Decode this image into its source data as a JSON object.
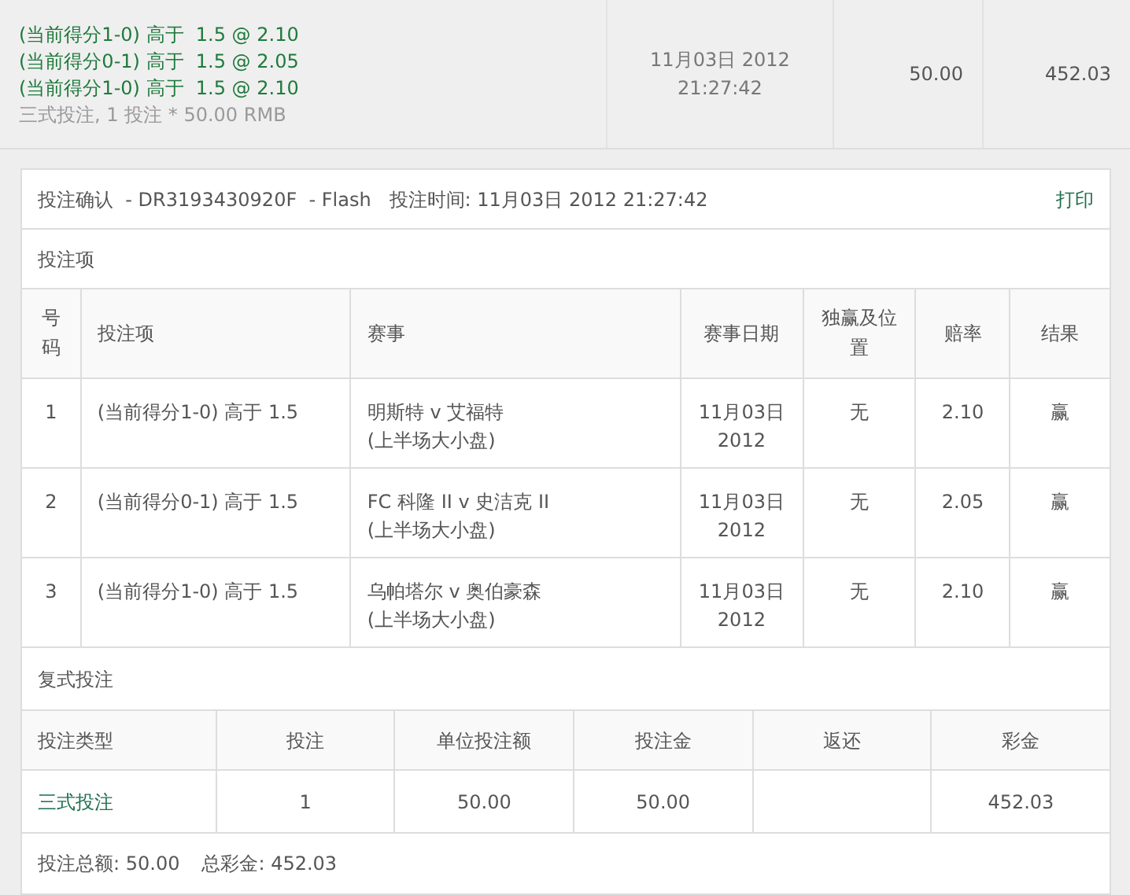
{
  "summary": {
    "selections": [
      "(当前得分1-0) 高于  1.5 @ 2.10",
      "(当前得分0-1) 高于  1.5 @ 2.05",
      "(当前得分1-0) 高于  1.5 @ 2.10"
    ],
    "bet_info": "三式投注, 1 投注 * 50.00 RMB",
    "date": "11月03日 2012",
    "time": "21:27:42",
    "stake": "50.00",
    "return": "452.03"
  },
  "confirmation": {
    "title": "投注确认  - DR3193430920F  - Flash   投注时间: 11月03日 2012 21:27:42",
    "print_link": "打印"
  },
  "selections_section": {
    "title": "投注项",
    "columns": [
      "号码",
      "投注项",
      "赛事",
      "赛事日期",
      "独赢及位置",
      "赔率",
      "结果"
    ],
    "rows": [
      {
        "number": "1",
        "selection": "(当前得分1-0) 高于 1.5",
        "event": "明斯特 v 艾福特",
        "market": "(上半场大小盘)",
        "date": "11月03日",
        "year": "2012",
        "each_way": "无",
        "odds": "2.10",
        "result": "赢"
      },
      {
        "number": "2",
        "selection": "(当前得分0-1) 高于 1.5",
        "event": "FC 科隆 II v 史洁克 II",
        "market": "(上半场大小盘)",
        "date": "11月03日",
        "year": "2012",
        "each_way": "无",
        "odds": "2.05",
        "result": "赢"
      },
      {
        "number": "3",
        "selection": "(当前得分1-0) 高于 1.5",
        "event": "乌帕塔尔 v 奥伯豪森",
        "market": "(上半场大小盘)",
        "date": "11月03日",
        "year": "2012",
        "each_way": "无",
        "odds": "2.10",
        "result": "赢"
      }
    ]
  },
  "multiple_section": {
    "title": "复式投注",
    "columns": [
      "投注类型",
      "投注",
      "单位投注额",
      "投注金",
      "返还",
      "彩金"
    ],
    "rows": [
      {
        "bet_type": "三式投注",
        "bets": "1",
        "unit_stake": "50.00",
        "stake": "50.00",
        "winnings": "452.03"
      }
    ]
  },
  "totals": {
    "total_stake": "投注总额: 50.00",
    "total_winnings": "总彩金: 452.03"
  }
}
